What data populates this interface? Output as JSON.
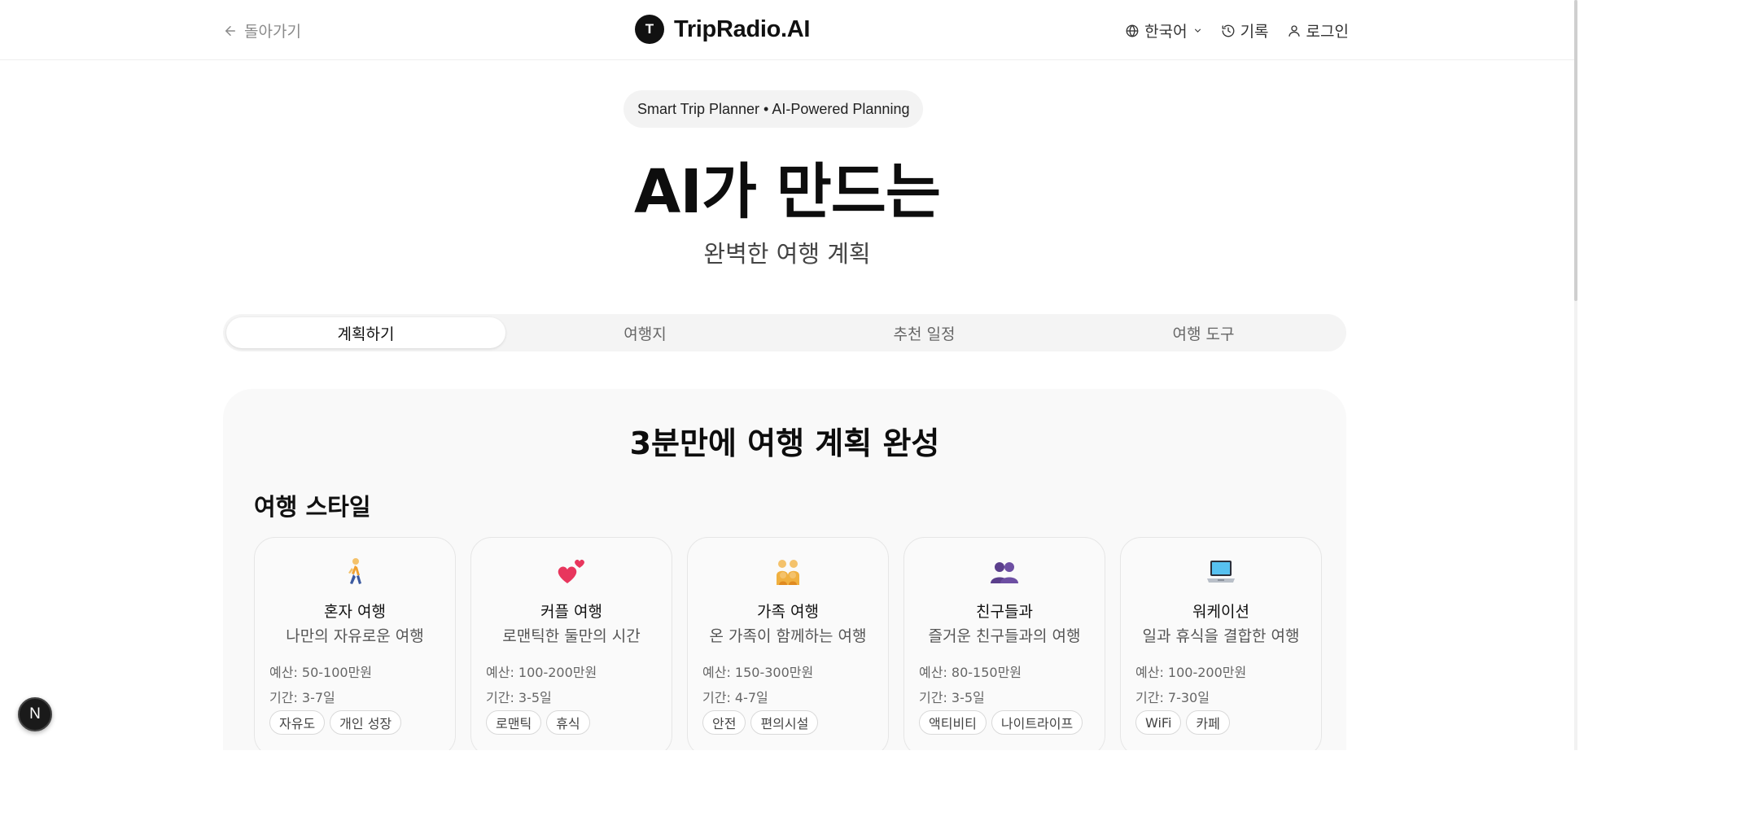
{
  "header": {
    "back_label": "돌아가기",
    "brand_initial": "T",
    "brand_name": "TripRadio.AI",
    "language_label": "한국어",
    "history_label": "기록",
    "login_label": "로그인"
  },
  "hero": {
    "badge": "Smart Trip Planner • AI-Powered Planning",
    "title": "AI가 만드는",
    "subtitle": "완벽한 여행 계획"
  },
  "tabs": [
    {
      "label": "계획하기",
      "active": true
    },
    {
      "label": "여행지",
      "active": false
    },
    {
      "label": "추천 일정",
      "active": false
    },
    {
      "label": "여행 도구",
      "active": false
    }
  ],
  "panel": {
    "title": "3분만에 여행 계획 완성",
    "section_title": "여행 스타일"
  },
  "styles": [
    {
      "icon": "walking-person-icon",
      "name": "혼자 여행",
      "desc": "나만의 자유로운 여행",
      "budget": "예산: 50-100만원",
      "duration": "기간: 3-7일",
      "tags": [
        "자유도",
        "개인 성장"
      ]
    },
    {
      "icon": "two-hearts-icon",
      "name": "커플 여행",
      "desc": "로맨틱한 둘만의 시간",
      "budget": "예산: 100-200만원",
      "duration": "기간: 3-5일",
      "tags": [
        "로맨틱",
        "휴식"
      ]
    },
    {
      "icon": "family-icon",
      "name": "가족 여행",
      "desc": "온 가족이 함께하는 여행",
      "budget": "예산: 150-300만원",
      "duration": "기간: 4-7일",
      "tags": [
        "안전",
        "편의시설"
      ]
    },
    {
      "icon": "friends-group-icon",
      "name": "친구들과",
      "desc": "즐거운 친구들과의 여행",
      "budget": "예산: 80-150만원",
      "duration": "기간: 3-5일",
      "tags": [
        "액티비티",
        "나이트라이프"
      ]
    },
    {
      "icon": "laptop-icon",
      "name": "워케이션",
      "desc": "일과 휴식을 결합한 여행",
      "budget": "예산: 100-200만원",
      "duration": "기간: 7-30일",
      "tags": [
        "WiFi",
        "카페"
      ]
    }
  ],
  "dev_badge": "N"
}
